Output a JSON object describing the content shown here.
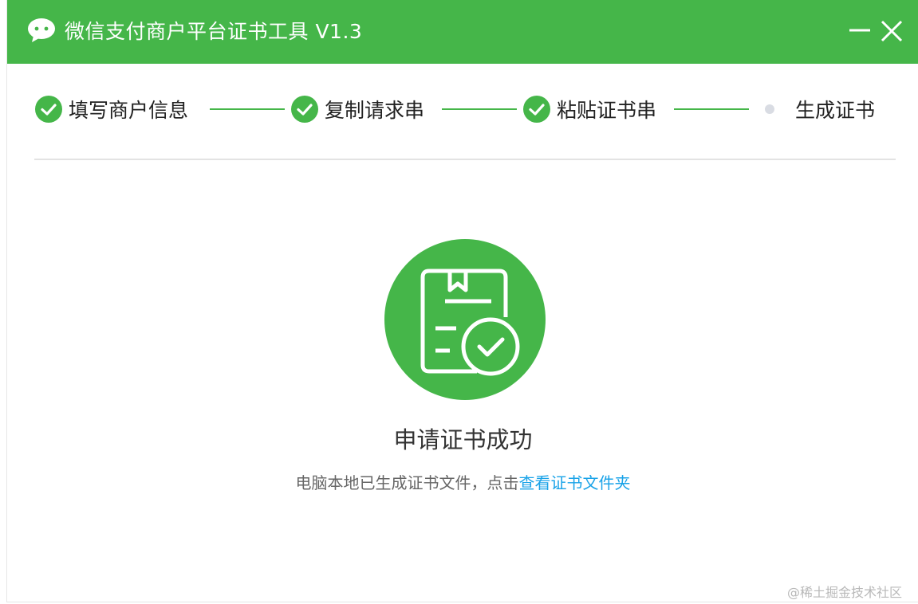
{
  "titlebar": {
    "title": "微信支付商户平台证书工具 V1.3",
    "logo_icon": "wechat-logo-icon",
    "minimize_icon": "minimize-icon",
    "close_icon": "close-icon",
    "background_color": "#45b649"
  },
  "steps": [
    {
      "label": "填写商户信息",
      "status": "done"
    },
    {
      "label": "复制请求串",
      "status": "done"
    },
    {
      "label": "粘贴证书串",
      "status": "done"
    },
    {
      "label": "生成证书",
      "status": "current"
    }
  ],
  "result": {
    "icon": "certificate-success-icon",
    "title": "申请证书成功",
    "description": "电脑本地已生成证书文件，点击",
    "link_text": "查看证书文件夹"
  },
  "watermark": "@稀土掘金技术社区",
  "colors": {
    "accent": "#45b649",
    "link": "#1aa3e8",
    "pending_dot": "#d9dce3"
  }
}
